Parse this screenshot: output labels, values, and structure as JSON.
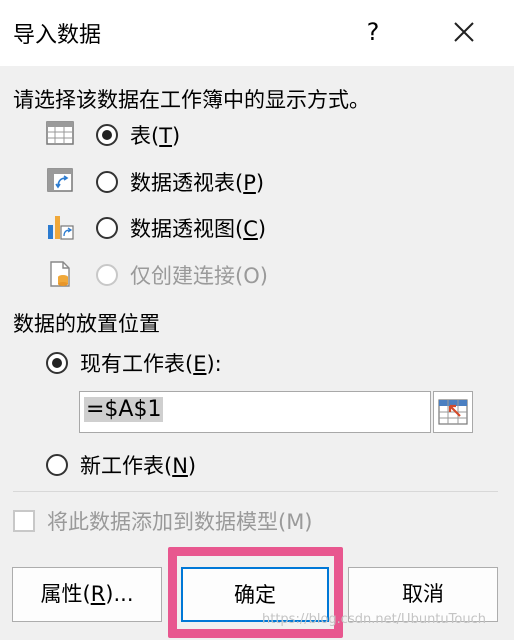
{
  "dialog": {
    "title": "导入数据",
    "help_label": "?",
    "prompt": "请选择该数据在工作簿中的显示方式。"
  },
  "view_options": [
    {
      "pre": "表(",
      "key": "T",
      "post": ")",
      "selected": true,
      "disabled": false,
      "icon": "table-icon"
    },
    {
      "pre": "数据透视表(",
      "key": "P",
      "post": ")",
      "selected": false,
      "disabled": false,
      "icon": "pivot-table-icon"
    },
    {
      "pre": "数据透视图(",
      "key": "C",
      "post": ")",
      "selected": false,
      "disabled": false,
      "icon": "pivot-chart-icon"
    },
    {
      "pre": "仅创建连接(O)",
      "key": "",
      "post": "",
      "selected": false,
      "disabled": true,
      "icon": "connection-only-icon"
    }
  ],
  "placement": {
    "heading": "数据的放置位置",
    "existing": {
      "pre": "现有工作表(",
      "key": "E",
      "post": "):",
      "selected": true
    },
    "cell_ref": "=$A$1",
    "new_sheet": {
      "pre": "新工作表(",
      "key": "N",
      "post": ")",
      "selected": false
    }
  },
  "data_model": {
    "label": "将此数据添加到数据模型(M)",
    "checked": false,
    "disabled": true
  },
  "buttons": {
    "properties": {
      "pre": "属性(",
      "key": "R",
      "post": ")..."
    },
    "ok": "确定",
    "cancel": "取消"
  },
  "watermark": "https://blog.csdn.net/UbuntuTouch",
  "colors": {
    "accent": "#0078d7",
    "highlight": "#e8578f"
  }
}
